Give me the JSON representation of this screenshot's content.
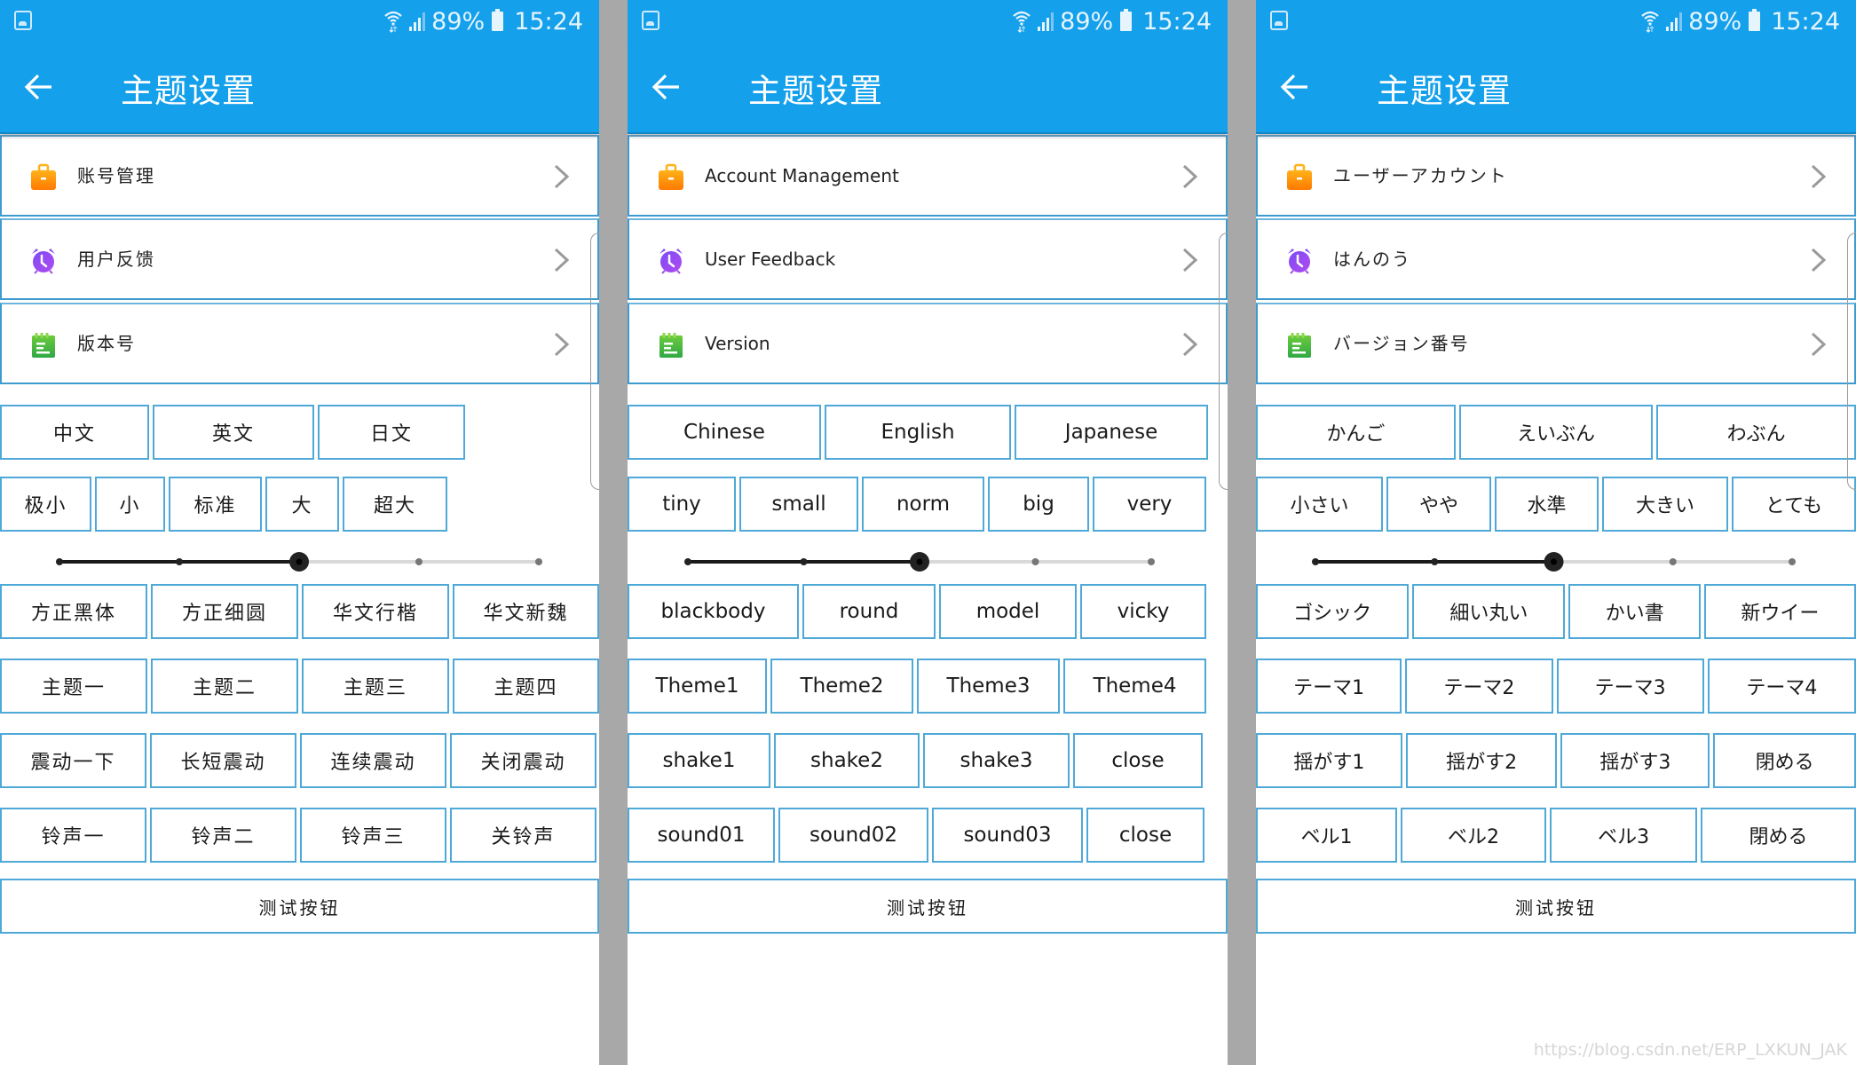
{
  "status_bar": {
    "battery": "89%",
    "time": "15:24"
  },
  "colors": {
    "accent": "#14A0EB",
    "border": "#4FA9D8",
    "divider": "#A8A8A8"
  },
  "slider": {
    "positions": 5,
    "selected_index": 2
  },
  "panels": [
    {
      "title": "主题设置",
      "menu": [
        {
          "icon": "briefcase-icon",
          "label": "账号管理"
        },
        {
          "icon": "alarm-clock-icon",
          "label": "用户反馈"
        },
        {
          "icon": "notepad-icon",
          "label": "版本号"
        }
      ],
      "languages": [
        "中文",
        "英文",
        "日文"
      ],
      "sizes": [
        "极小",
        "小",
        "标准",
        "大",
        "超大"
      ],
      "fonts": [
        "方正黑体",
        "方正细圆",
        "华文行楷",
        "华文新魏"
      ],
      "themes": [
        "主题一",
        "主题二",
        "主题三",
        "主题四"
      ],
      "vibrations": [
        "震动一下",
        "长短震动",
        "连续震动",
        "关闭震动"
      ],
      "sounds": [
        "铃声一",
        "铃声二",
        "铃声三",
        "关铃声"
      ],
      "test_button": "测试按钮"
    },
    {
      "title": "主题设置",
      "menu": [
        {
          "icon": "briefcase-icon",
          "label": "Account Management"
        },
        {
          "icon": "alarm-clock-icon",
          "label": "User Feedback"
        },
        {
          "icon": "notepad-icon",
          "label": "Version"
        }
      ],
      "languages": [
        "Chinese",
        "English",
        "Japanese"
      ],
      "sizes": [
        "tiny",
        "small",
        "norm",
        "big",
        "very"
      ],
      "fonts": [
        "blackbody",
        "round",
        "model",
        "vicky"
      ],
      "themes": [
        "Theme1",
        "Theme2",
        "Theme3",
        "Theme4"
      ],
      "vibrations": [
        "shake1",
        "shake2",
        "shake3",
        "close"
      ],
      "sounds": [
        "sound01",
        "sound02",
        "sound03",
        "close"
      ],
      "test_button": "测试按钮"
    },
    {
      "title": "主题设置",
      "menu": [
        {
          "icon": "briefcase-icon",
          "label": "ユーザーアカウント"
        },
        {
          "icon": "alarm-clock-icon",
          "label": "はんのう"
        },
        {
          "icon": "notepad-icon",
          "label": "バージョン番号"
        }
      ],
      "languages": [
        "かんご",
        "えいぶん",
        "わぶん"
      ],
      "sizes": [
        "小さい",
        "やや",
        "水準",
        "大きい",
        "とても"
      ],
      "fonts": [
        "ゴシック",
        "細い丸い",
        "かい書",
        "新ウイー"
      ],
      "themes": [
        "テーマ1",
        "テーマ2",
        "テーマ3",
        "テーマ4"
      ],
      "vibrations": [
        "揺がす1",
        "揺がす2",
        "揺がす3",
        "閉める"
      ],
      "sounds": [
        "ベル1",
        "ベル2",
        "ベル3",
        "閉める"
      ],
      "test_button": "测试按钮"
    }
  ],
  "watermark": "https://blog.csdn.net/ERP_LXKUN_JAK"
}
